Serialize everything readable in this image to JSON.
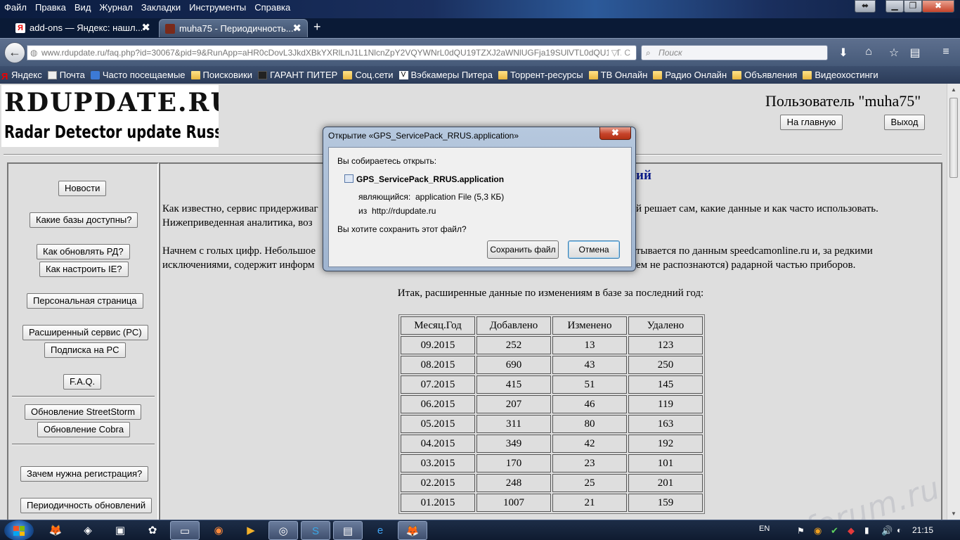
{
  "browser": {
    "menu": [
      "Файл",
      "Правка",
      "Вид",
      "Журнал",
      "Закладки",
      "Инструменты",
      "Справка"
    ],
    "tabs": [
      {
        "title": "add-ons — Яндекс: нашл...",
        "close": "✖",
        "active": false
      },
      {
        "title": "muha75 - Периодичность...",
        "close": "✖",
        "active": true
      }
    ],
    "new_tab": "+",
    "url": "www.rdupdate.ru/faq.php?id=30067&pid=9&RunApp=aHR0cDovL3JkdXBkYXRlLnJ1L1NlcnZpY2VQYWNrL0dQU19TZXJ2aWNlUGFja19SUlVTL0dQU19TZ",
    "search_placeholder": "Поиск",
    "bookmarks": [
      "Яндекс",
      "Почта",
      "Часто посещаемые",
      "Поисковики",
      "ГАРАНТ ПИТЕР",
      "Соц.сети",
      "Вэбкамеры Питера",
      "Торрент-ресурсы",
      "ТВ Онлайн",
      "Радио Онлайн",
      "Объявления",
      "Видеохостинги"
    ]
  },
  "site": {
    "logo_line1": "RDUPDATE.RU",
    "logo_line2": "Radar Detector update Russian site",
    "user": "Пользователь \"muha75\"",
    "home_button": "На главную",
    "logout_button": "Выход",
    "sidebar": [
      "Новости",
      "Какие базы доступны?",
      "Как обновлять РД?",
      "Как настроить IE?",
      "Персональная страница",
      "Расширенный сервис (PC)",
      "Подписка на PC",
      "F.A.Q.",
      "Обновление StreetStorm",
      "Обновление Cobra",
      "Зачем нужна регистрация?",
      "Периодичность обновлений"
    ],
    "heading_visible": "ий",
    "para1_line1_left": "Как известно, сервис придерживаг",
    "para1_line1_right": "й решает сам, какие данные и как часто использовать.",
    "para1_line2": "Нижеприведенная аналитика, воз",
    "para2_line1_left": "Начнем с голых цифр. Небольшое",
    "para2_line1_right": "тывается по данным speedcamonline.ru и, за редкими",
    "para2_line2_left": "исключениями, содержит информ",
    "para2_line2_right": "ем не распознаются) радарной частью приборов.",
    "table_intro": "Итак, расширенные данные по изменениям в базе за последний год:",
    "table": {
      "headers": [
        "Месяц.Год",
        "Добавлено",
        "Изменено",
        "Удалено"
      ],
      "rows": [
        [
          "09.2015",
          "252",
          "13",
          "123"
        ],
        [
          "08.2015",
          "690",
          "43",
          "250"
        ],
        [
          "07.2015",
          "415",
          "51",
          "145"
        ],
        [
          "06.2015",
          "207",
          "46",
          "119"
        ],
        [
          "05.2015",
          "311",
          "80",
          "163"
        ],
        [
          "04.2015",
          "349",
          "42",
          "192"
        ],
        [
          "03.2015",
          "170",
          "23",
          "101"
        ],
        [
          "02.2015",
          "248",
          "25",
          "201"
        ],
        [
          "01.2015",
          "1007",
          "21",
          "159"
        ]
      ]
    }
  },
  "dialog": {
    "title": "Открытие «GPS_ServicePack_RRUS.application»",
    "close": "✖",
    "prompt": "Вы собираетесь открыть:",
    "filename": "GPS_ServicePack_RRUS.application",
    "type_label": "являющийся:",
    "type_value": "application File (5,3 КБ)",
    "from_label": "из",
    "from_value": "http://rdupdate.ru",
    "question": "Вы хотите сохранить этот файл?",
    "save_button": "Сохранить файл",
    "cancel_button": "Отмена"
  },
  "watermark": "rd-forum.ru",
  "taskbar": {
    "language": "EN",
    "clock": "21:15"
  }
}
